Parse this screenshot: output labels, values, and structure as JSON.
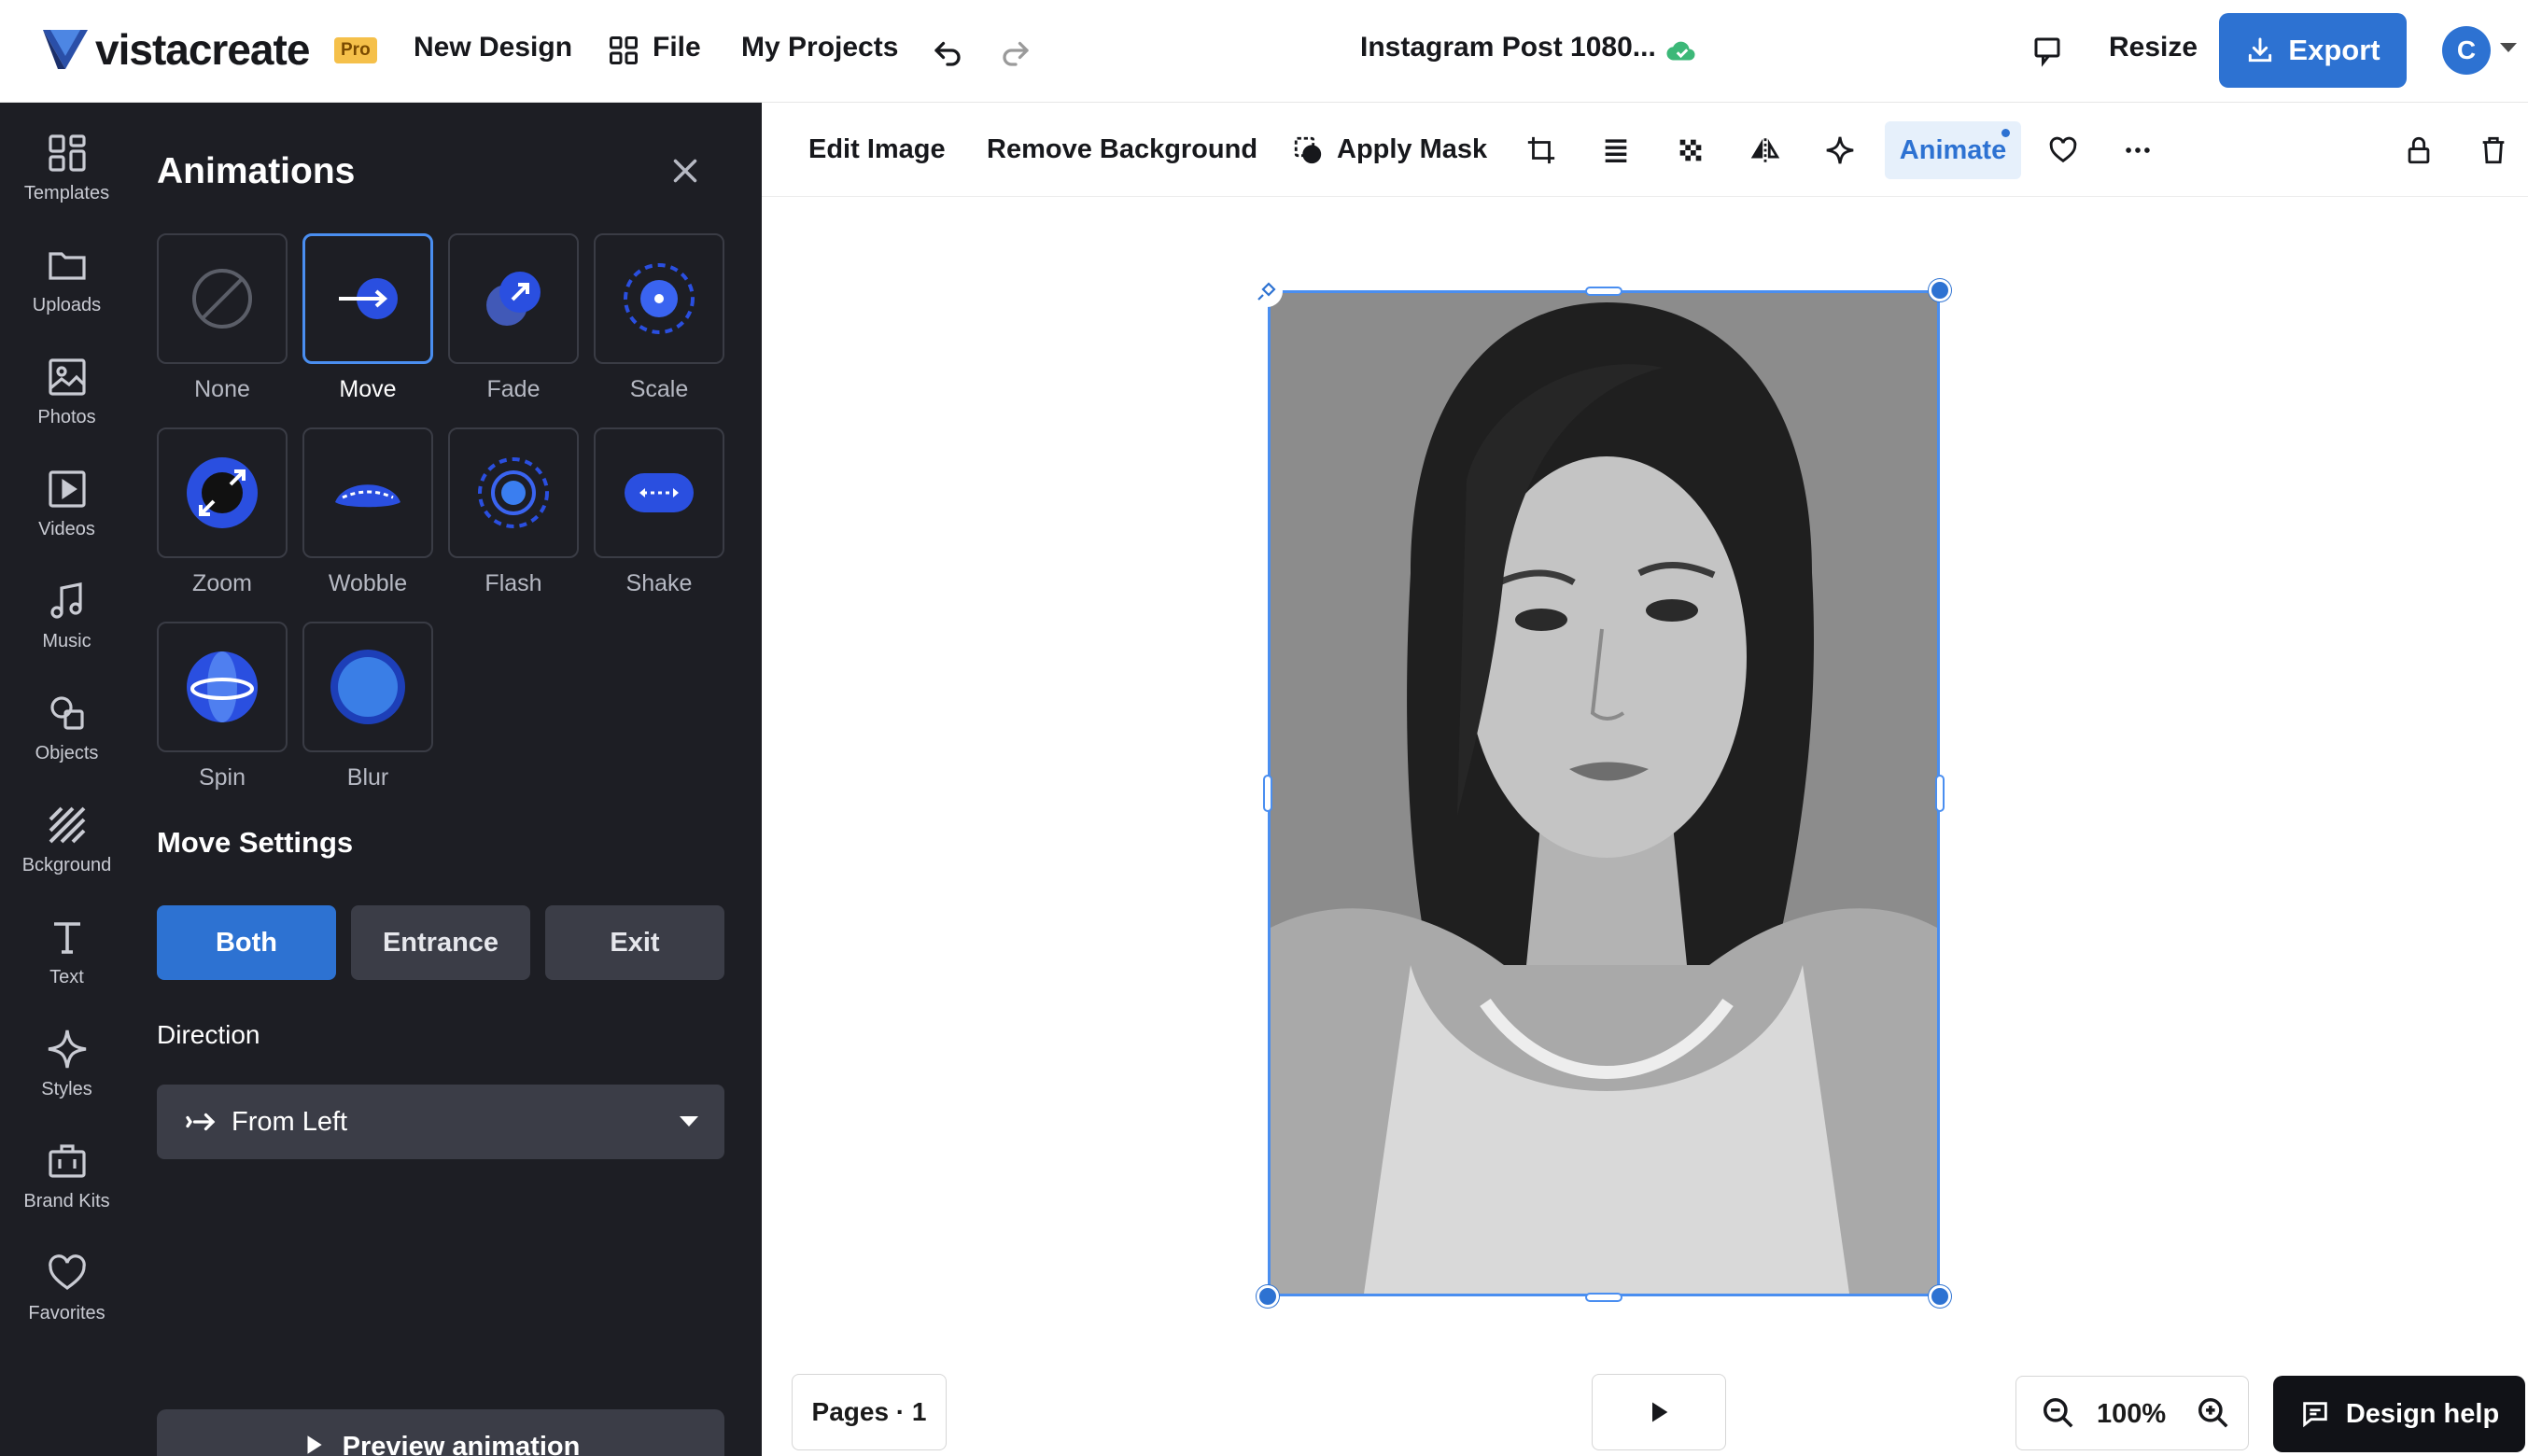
{
  "topbar": {
    "logo_text": "vistacreate",
    "pro_badge": "Pro",
    "new_design": "New Design",
    "file": "File",
    "my_projects": "My Projects",
    "document_title": "Instagram Post 1080...",
    "resize": "Resize",
    "export": "Export",
    "avatar_initial": "C",
    "accent_color": "#2d72d2"
  },
  "rail": {
    "items": [
      {
        "label": "Templates",
        "icon": "templates-icon"
      },
      {
        "label": "Uploads",
        "icon": "folder-icon"
      },
      {
        "label": "Photos",
        "icon": "image-icon"
      },
      {
        "label": "Videos",
        "icon": "video-icon"
      },
      {
        "label": "Music",
        "icon": "music-icon"
      },
      {
        "label": "Objects",
        "icon": "shapes-icon"
      },
      {
        "label": "Bckground",
        "icon": "stripes-icon"
      },
      {
        "label": "Text",
        "icon": "text-icon"
      },
      {
        "label": "Styles",
        "icon": "sparkle-icon"
      },
      {
        "label": "Brand Kits",
        "icon": "briefcase-icon"
      },
      {
        "label": "Favorites",
        "icon": "heart-icon"
      }
    ]
  },
  "panel": {
    "title": "Animations",
    "animations": [
      {
        "label": "None",
        "selected": false
      },
      {
        "label": "Move",
        "selected": true
      },
      {
        "label": "Fade",
        "selected": false
      },
      {
        "label": "Scale",
        "selected": false
      },
      {
        "label": "Zoom",
        "selected": false
      },
      {
        "label": "Wobble",
        "selected": false
      },
      {
        "label": "Flash",
        "selected": false
      },
      {
        "label": "Shake",
        "selected": false
      },
      {
        "label": "Spin",
        "selected": false
      },
      {
        "label": "Blur",
        "selected": false
      }
    ],
    "settings_title": "Move Settings",
    "segments": [
      {
        "label": "Both",
        "active": true
      },
      {
        "label": "Entrance",
        "active": false
      },
      {
        "label": "Exit",
        "active": false
      }
    ],
    "direction_label": "Direction",
    "direction_value": "From Left",
    "preview_button": "Preview animation"
  },
  "context_toolbar": {
    "edit_image": "Edit Image",
    "remove_background": "Remove Background",
    "apply_mask": "Apply Mask",
    "animate": "Animate"
  },
  "bottom": {
    "pages": "Pages · 1",
    "zoom": "100%",
    "design_help": "Design help"
  }
}
